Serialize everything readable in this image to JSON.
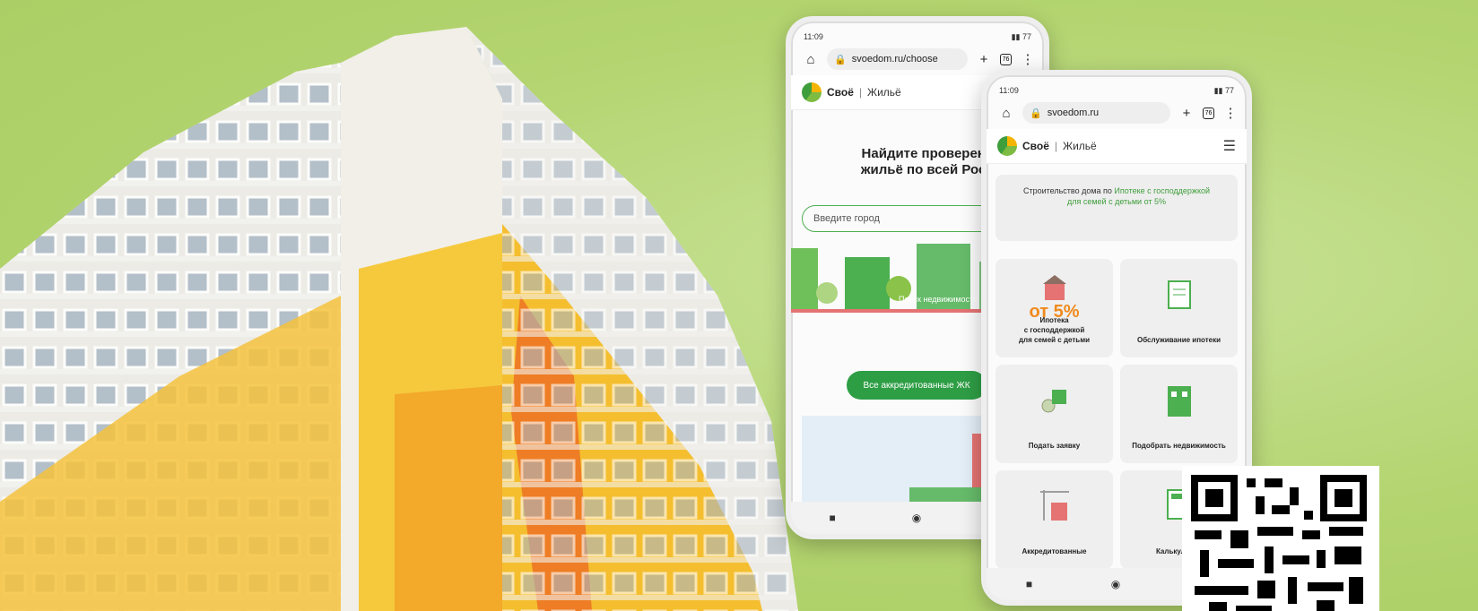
{
  "phone_back": {
    "status_time": "11:09",
    "status_battery": "77",
    "url": "svoedom.ru/choose",
    "tab_count": "76",
    "brand_name": "Своё",
    "brand_section": "Жильё",
    "hero_title": "Найдите проверенное\nжильё по всей России",
    "city_placeholder": "Введите город",
    "search_caption": "Поиск недвижимости",
    "cta_label": "Все аккредитованные ЖК"
  },
  "phone_front": {
    "status_time": "11:09",
    "status_battery": "77",
    "url": "svoedom.ru",
    "tab_count": "76",
    "brand_name": "Своё",
    "brand_section": "Жильё",
    "banner_text_1": "Строительство дома по ",
    "banner_text_highlight": "Ипотеке с господдержкой для семей с детьми от 5%",
    "cards": [
      {
        "big": "от 5%",
        "label": "Ипотека\nс господдержкой\nдля семей с детьми"
      },
      {
        "label": "Обслуживание ипотеки"
      },
      {
        "label": "Подать заявку"
      },
      {
        "label": "Подобрать недвижимость"
      },
      {
        "label": "Аккредитованные"
      },
      {
        "label": "Калькулятор"
      }
    ]
  },
  "colors": {
    "brand_green": "#2e9e45",
    "accent_orange": "#f08a1c",
    "background": "#b3d46f"
  }
}
